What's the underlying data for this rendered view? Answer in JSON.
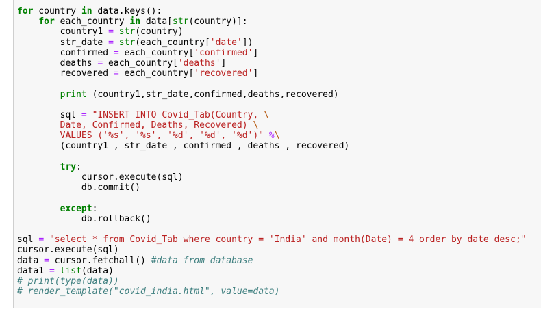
{
  "notebook": {
    "code_lines": [
      [
        {
          "t": "for",
          "c": "kw"
        },
        {
          "t": " country "
        },
        {
          "t": "in",
          "c": "kw"
        },
        {
          "t": " data.keys():"
        }
      ],
      [
        {
          "t": "    "
        },
        {
          "t": "for",
          "c": "kw"
        },
        {
          "t": " each_country "
        },
        {
          "t": "in",
          "c": "kw"
        },
        {
          "t": " data["
        },
        {
          "t": "str",
          "c": "bi"
        },
        {
          "t": "(country)]:"
        }
      ],
      [
        {
          "t": "        country1 "
        },
        {
          "t": "=",
          "c": "op"
        },
        {
          "t": " "
        },
        {
          "t": "str",
          "c": "bi"
        },
        {
          "t": "(country)"
        }
      ],
      [
        {
          "t": "        str_date "
        },
        {
          "t": "=",
          "c": "op"
        },
        {
          "t": " "
        },
        {
          "t": "str",
          "c": "bi"
        },
        {
          "t": "(each_country["
        },
        {
          "t": "'date'",
          "c": "st"
        },
        {
          "t": "])"
        }
      ],
      [
        {
          "t": "        confirmed "
        },
        {
          "t": "=",
          "c": "op"
        },
        {
          "t": " each_country["
        },
        {
          "t": "'confirmed'",
          "c": "st"
        },
        {
          "t": "]"
        }
      ],
      [
        {
          "t": "        deaths "
        },
        {
          "t": "=",
          "c": "op"
        },
        {
          "t": " each_country["
        },
        {
          "t": "'deaths'",
          "c": "st"
        },
        {
          "t": "]"
        }
      ],
      [
        {
          "t": "        recovered "
        },
        {
          "t": "=",
          "c": "op"
        },
        {
          "t": " each_country["
        },
        {
          "t": "'recovered'",
          "c": "st"
        },
        {
          "t": "]"
        }
      ],
      [
        {
          "t": ""
        }
      ],
      [
        {
          "t": "        "
        },
        {
          "t": "print",
          "c": "bi"
        },
        {
          "t": " (country1,str_date,confirmed,deaths,recovered)"
        }
      ],
      [
        {
          "t": ""
        }
      ],
      [
        {
          "t": "        sql "
        },
        {
          "t": "=",
          "c": "op"
        },
        {
          "t": " "
        },
        {
          "t": "\"INSERT INTO Covid_Tab(Country, ",
          "c": "st"
        },
        {
          "t": "\\",
          "c": "esc"
        }
      ],
      [
        {
          "t": "        "
        },
        {
          "t": "Date, Confirmed, Deaths, Recovered) ",
          "c": "st"
        },
        {
          "t": "\\",
          "c": "esc"
        }
      ],
      [
        {
          "t": "        "
        },
        {
          "t": "VALUES ('%s', '%s', '%d', '%d', '%d')\"",
          "c": "st"
        },
        {
          "t": " "
        },
        {
          "t": "%",
          "c": "op"
        },
        {
          "t": "\\",
          "c": "esc"
        }
      ],
      [
        {
          "t": "        (country1 , str_date , confirmed , deaths , recovered)"
        }
      ],
      [
        {
          "t": ""
        }
      ],
      [
        {
          "t": "        "
        },
        {
          "t": "try",
          "c": "kw"
        },
        {
          "t": ":"
        }
      ],
      [
        {
          "t": "            cursor.execute(sql)"
        }
      ],
      [
        {
          "t": "            db.commit()"
        }
      ],
      [
        {
          "t": ""
        }
      ],
      [
        {
          "t": "        "
        },
        {
          "t": "except",
          "c": "kw"
        },
        {
          "t": ":"
        }
      ],
      [
        {
          "t": "            db.rollback()"
        }
      ],
      [
        {
          "t": ""
        }
      ],
      [
        {
          "t": "sql "
        },
        {
          "t": "=",
          "c": "op"
        },
        {
          "t": " "
        },
        {
          "t": "\"select * from Covid_Tab where country = 'India' and month(Date) = 4 order by date desc;\"",
          "c": "st"
        }
      ],
      [
        {
          "t": "cursor.execute(sql)"
        }
      ],
      [
        {
          "t": "data "
        },
        {
          "t": "=",
          "c": "op"
        },
        {
          "t": " cursor.fetchall() "
        },
        {
          "t": "#data from database",
          "c": "cm"
        }
      ],
      [
        {
          "t": "data1 "
        },
        {
          "t": "=",
          "c": "op"
        },
        {
          "t": " "
        },
        {
          "t": "list",
          "c": "bi"
        },
        {
          "t": "(data)"
        }
      ],
      [
        {
          "t": "# print(type(data))",
          "c": "cm"
        }
      ],
      [
        {
          "t": "# render_template(\"covid_india.html\", value=data)",
          "c": "cm"
        }
      ]
    ]
  },
  "colors": {
    "keyword": "#008000",
    "operator": "#aa22ff",
    "builtin": "#008000",
    "string": "#ba2121",
    "comment": "#408080",
    "cell_background": "#f7f7f7"
  }
}
